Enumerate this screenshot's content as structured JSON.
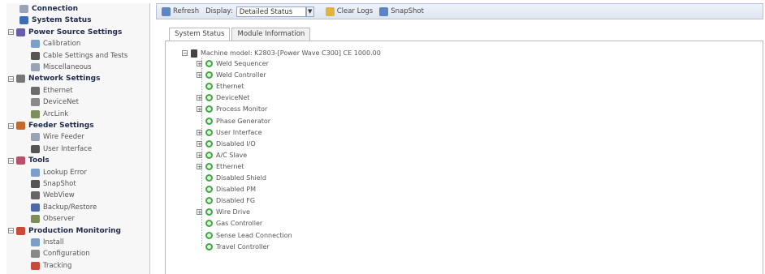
{
  "sidebar": {
    "rows": [
      {
        "type": "child",
        "label": "Connection",
        "indent": 14,
        "icon": "plug-icon",
        "color": "#9aa3b5",
        "bold": true
      },
      {
        "type": "child",
        "label": "System Status",
        "indent": 14,
        "icon": "status-icon",
        "color": "#3f6db5",
        "bold": true
      },
      {
        "type": "header",
        "label": "Power Source Settings",
        "indent": 0,
        "icon": "power-source-icon",
        "color": "#6b5ea8"
      },
      {
        "type": "child",
        "label": "Calibration",
        "indent": 28,
        "icon": "calibration-icon",
        "color": "#7aa0c8"
      },
      {
        "type": "child",
        "label": "Cable Settings and Tests",
        "indent": 28,
        "icon": "cable-icon",
        "color": "#555"
      },
      {
        "type": "child",
        "label": "Miscellaneous",
        "indent": 28,
        "icon": "misc-icon",
        "color": "#9aa3b5"
      },
      {
        "type": "header",
        "label": "Network Settings",
        "indent": 0,
        "icon": "network-icon",
        "color": "#777"
      },
      {
        "type": "child",
        "label": "Ethernet",
        "indent": 28,
        "icon": "ethernet-icon",
        "color": "#6b6b6b"
      },
      {
        "type": "child",
        "label": "DeviceNet",
        "indent": 28,
        "icon": "devicenet-icon",
        "color": "#8a8a8a"
      },
      {
        "type": "child",
        "label": "ArcLink",
        "indent": 28,
        "icon": "arclink-icon",
        "color": "#7b8e5b"
      },
      {
        "type": "header",
        "label": "Feeder Settings",
        "indent": 0,
        "icon": "feeder-icon",
        "color": "#c46a2e"
      },
      {
        "type": "child",
        "label": "Wire Feeder",
        "indent": 28,
        "icon": "wire-feeder-icon",
        "color": "#9aa3b5"
      },
      {
        "type": "child",
        "label": "User Interface",
        "indent": 28,
        "icon": "user-interface-icon",
        "color": "#555"
      },
      {
        "type": "header",
        "label": "Tools",
        "indent": 0,
        "icon": "tools-icon",
        "color": "#b8506b"
      },
      {
        "type": "child",
        "label": "Lookup Error",
        "indent": 28,
        "icon": "lookup-icon",
        "color": "#7aa0c8"
      },
      {
        "type": "child",
        "label": "SnapShot",
        "indent": 28,
        "icon": "snapshot-icon",
        "color": "#555"
      },
      {
        "type": "child",
        "label": "WebView",
        "indent": 28,
        "icon": "webview-icon",
        "color": "#666"
      },
      {
        "type": "child",
        "label": "Backup/Restore",
        "indent": 28,
        "icon": "backup-icon",
        "color": "#4d6aa8"
      },
      {
        "type": "child",
        "label": "Observer",
        "indent": 28,
        "icon": "observer-icon",
        "color": "#7b8e5b"
      },
      {
        "type": "header",
        "label": "Production Monitoring",
        "indent": 0,
        "icon": "production-icon",
        "color": "#c74a3a"
      },
      {
        "type": "child",
        "label": "Install",
        "indent": 28,
        "icon": "install-icon",
        "color": "#7aa0c8"
      },
      {
        "type": "child",
        "label": "Configuration",
        "indent": 28,
        "icon": "configuration-icon",
        "color": "#888"
      },
      {
        "type": "child",
        "label": "Tracking",
        "indent": 28,
        "icon": "tracking-icon",
        "color": "#c74a3a"
      }
    ]
  },
  "toolbar": {
    "refresh_label": "Refresh",
    "display_label": "Display:",
    "display_value": "Detailed Status",
    "clear_logs_label": "Clear Logs",
    "snapshot_label": "SnapShot"
  },
  "tabs": [
    {
      "label": "System Status",
      "active": true
    },
    {
      "label": "Module Information",
      "active": false
    }
  ],
  "tree": {
    "root_label": "Machine model: K2803-[Power Wave C300] CE 1000.00",
    "items": [
      {
        "label": "Weld Sequencer",
        "expandable": true
      },
      {
        "label": "Weld Controller",
        "expandable": true
      },
      {
        "label": "Ethernet",
        "expandable": false
      },
      {
        "label": "DeviceNet",
        "expandable": true
      },
      {
        "label": "Process Monitor",
        "expandable": true
      },
      {
        "label": "Phase Generator",
        "expandable": false
      },
      {
        "label": "User Interface",
        "expandable": true
      },
      {
        "label": "Disabled I/O",
        "expandable": true
      },
      {
        "label": "A/C Slave",
        "expandable": true
      },
      {
        "label": "Ethernet",
        "expandable": true
      },
      {
        "label": "Disabled Shield",
        "expandable": false
      },
      {
        "label": "Disabled PM",
        "expandable": false
      },
      {
        "label": "Disabled FG",
        "expandable": false
      },
      {
        "label": "Wire Drive",
        "expandable": true
      },
      {
        "label": "Gas Controller",
        "expandable": false
      },
      {
        "label": "Sense Lead Connection",
        "expandable": false
      },
      {
        "label": "Travel Controller",
        "expandable": false
      }
    ],
    "status_color": "#3fa83f"
  }
}
